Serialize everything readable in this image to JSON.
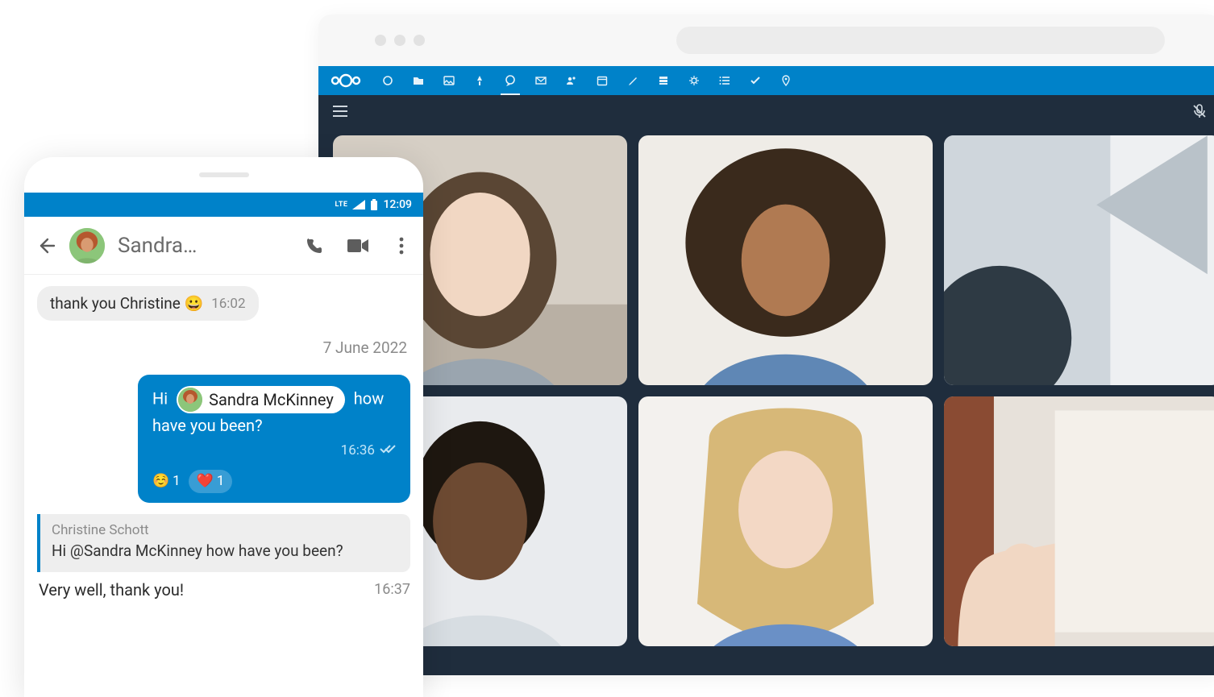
{
  "phone": {
    "status": {
      "network": "LTE",
      "clock": "12:09"
    },
    "header": {
      "title": "Sandra…",
      "contact_full": "Sandra McKinney"
    },
    "messages": {
      "in1": {
        "text": "thank you Christine 😀",
        "time": "16:02"
      },
      "date_sep": "7 June 2022",
      "out1": {
        "pre": "Hi",
        "mention": "Sandra McKinney",
        "post": "how have you been?",
        "time": "16:36",
        "reactions": [
          {
            "emoji": "☺️",
            "count": "1"
          },
          {
            "emoji": "❤️",
            "count": "1"
          }
        ]
      },
      "reply": {
        "sender": "Christine Schott",
        "quoted": "Hi  @Sandra McKinney  how have you been?",
        "text": "Very well, thank you!",
        "time": "16:37"
      }
    }
  },
  "desktop": {
    "topbar_icons": [
      "dashboard-icon",
      "files-icon",
      "photos-icon",
      "activity-icon",
      "talk-icon",
      "mail-icon",
      "contacts-icon",
      "calendar-icon",
      "notes-icon",
      "deck-icon",
      "forms-icon",
      "tasks-list-icon",
      "tasks-icon",
      "maps-icon"
    ],
    "participants": [
      "Participant 1",
      "Participant 2",
      "Participant 3",
      "Participant 4",
      "Participant 5",
      "Participant 6"
    ]
  }
}
